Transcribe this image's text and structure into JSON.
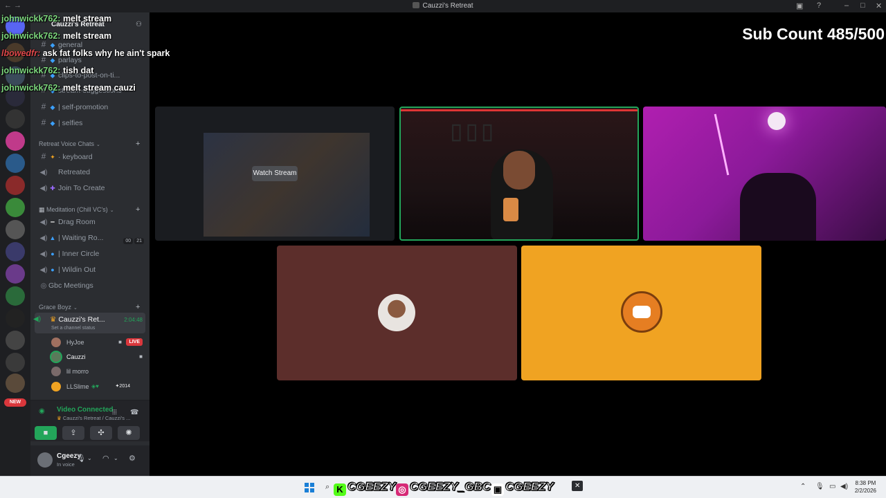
{
  "window": {
    "title": "Cauzzi's Retreat"
  },
  "overlay": {
    "sub_count": "Sub Count 485/500",
    "chat": [
      {
        "user": "johnwickk762:",
        "msg": "melt stream",
        "user_color": "#7dd87d"
      },
      {
        "user": "johnwickk762:",
        "msg": "melt stream",
        "user_color": "#7dd87d"
      },
      {
        "user": "lbowedfr:",
        "msg": "ask fat folks why he ain't spark",
        "user_color": "#e0484b"
      },
      {
        "user": "johnwickk762:",
        "msg": "tish dat",
        "user_color": "#7dd87d"
      },
      {
        "user": "johnwickk762:",
        "msg": "melt stream cauzi",
        "user_color": "#7dd87d"
      }
    ]
  },
  "sidebar": {
    "server_name": "Cauzzi's Retreat",
    "text_channels": [
      {
        "name": "general"
      },
      {
        "name": "parlays"
      },
      {
        "name": "clips-to-post-on-ti..."
      },
      {
        "name": "stream-suggestions"
      },
      {
        "name": "| self-promotion"
      },
      {
        "name": "| selfies"
      }
    ],
    "categories": {
      "retreat_voice": "Retreat Voice Chats",
      "meditation": "Meditation (Chill VC's)",
      "grace_boyz": "Grace Boyz"
    },
    "retreat_channels": [
      {
        "name": "· keyboard"
      },
      {
        "name": "Retreated"
      },
      {
        "name": "Join To Create"
      }
    ],
    "meditation_channels": [
      {
        "name": "Drag Room"
      },
      {
        "name": "| Waiting Ro...",
        "count_a": "00",
        "count_b": "21"
      },
      {
        "name": "| Inner Circle"
      },
      {
        "name": "| Wildin Out"
      },
      {
        "name": "Gbc Meetings"
      }
    ],
    "active_voice": {
      "name": "Cauzzi's Ret...",
      "time": "2:04:48",
      "status": "Set a channel status"
    },
    "members": [
      {
        "name": "HyJoe",
        "live": "LIVE"
      },
      {
        "name": "Cauzzi"
      },
      {
        "name": "lil morro"
      },
      {
        "name": "LLSlime",
        "tag": "2014"
      }
    ],
    "new_badge": "NEW",
    "voice_panel": {
      "status": "Video Connected",
      "channel": "Cauzzi's Retreat / Cauzzi's ..."
    },
    "user": {
      "name": "Cgeezy",
      "status": "In voice"
    }
  },
  "stage": {
    "watch_stream": "Watch Stream"
  },
  "taskbar": {
    "socials": [
      {
        "platform": "kick-icon",
        "handle": "CGEEZY"
      },
      {
        "platform": "instagram-icon",
        "handle": "CGEEZY_GBC"
      },
      {
        "platform": "twitch-icon",
        "handle": "CGEEZY"
      }
    ],
    "time": "8:38 PM",
    "date": "2/2/2026"
  },
  "colors": {
    "accent_green": "#23a55a",
    "live_red": "#da373c",
    "tile_orange": "#f0a322",
    "tile_brown": "#5c2e2b"
  }
}
